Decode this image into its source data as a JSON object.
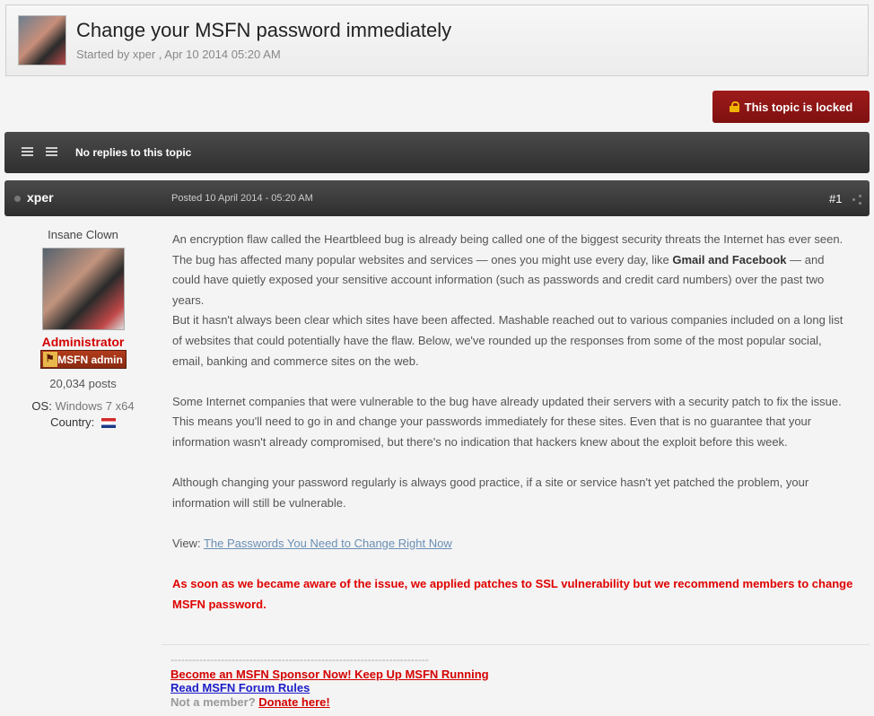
{
  "topic": {
    "title": "Change your MSFN password immediately",
    "meta": "Started by xper , Apr 10 2014 05:20 AM"
  },
  "locked_button": {
    "label": "This topic is locked"
  },
  "replies_bar": {
    "text": "No replies to this topic"
  },
  "post": {
    "author": "xper",
    "posted": "Posted 10 April 2014 - 05:20 AM",
    "number": "#1",
    "user": {
      "title": "Insane Clown",
      "role": "Administrator",
      "badge": "MSFN admin",
      "posts": "20,034 posts",
      "os_label": "OS:",
      "os_value": "Windows 7 x64",
      "country_label": "Country:"
    },
    "body": {
      "p1_a": "An encryption flaw called the Heartbleed bug is already being called one of the biggest security threats the Internet has ever seen. The bug has affected many popular websites and services — ones you might use every day, like ",
      "p1_bold": "Gmail and Facebook",
      "p1_b": " — and could have quietly exposed your sensitive account information (such as passwords and credit card numbers) over the past two years.",
      "p1_c": "But it hasn't always been clear which sites have been affected. Mashable reached out to various companies included on a long list of websites that could potentially have the flaw. Below, we've rounded up the responses from some of the most popular social, email, banking and commerce sites on the web.",
      "p2": "Some Internet companies that were vulnerable to the bug have already updated their servers with a security patch to fix the issue. This means you'll need to go in and change your passwords immediately for these sites. Even that is no guarantee that your information wasn't already compromised, but there's no indication that hackers knew about the exploit before this week.",
      "p3": "Although changing your password regularly is always good practice, if a site or service hasn't yet patched the problem, your information will still be vulnerable.",
      "view_label": "View: ",
      "view_link": "The Passwords You Need to Change Right Now",
      "note": "As soon as we became aware of the issue, we applied patches to SSL vulnerability but we recommend members to change MSFN password."
    }
  },
  "signature": {
    "dashes": "------------------------------------------------------------------------",
    "sponsor": "Become an MSFN Sponsor Now! Keep Up MSFN Running",
    "rules": "Read MSFN Forum Rules",
    "not_member": "Not a member? ",
    "donate": "Donate here!"
  },
  "colors": {
    "locked": "#8b1414",
    "role": "#d40000",
    "note": "#e00000",
    "link": "#6a8fb5",
    "rules": "#1c1cc8"
  }
}
